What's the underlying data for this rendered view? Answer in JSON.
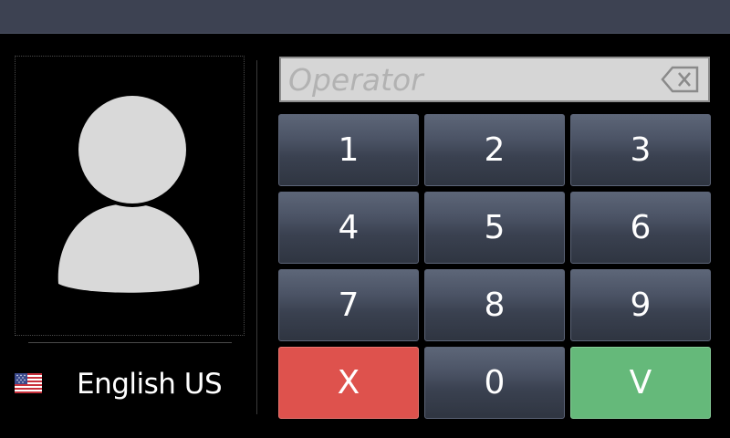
{
  "operator_input": {
    "placeholder": "Operator",
    "value": ""
  },
  "language": {
    "label": "English US",
    "flag_icon": "us-flag-icon"
  },
  "keypad": {
    "keys": [
      "1",
      "2",
      "3",
      "4",
      "5",
      "6",
      "7",
      "8",
      "9"
    ],
    "cancel_label": "X",
    "zero_label": "0",
    "confirm_label": "V"
  },
  "colors": {
    "topbar": "#3d4252",
    "cancel": "#de524d",
    "confirm": "#65b97a",
    "avatar": "#d9d9d9"
  }
}
